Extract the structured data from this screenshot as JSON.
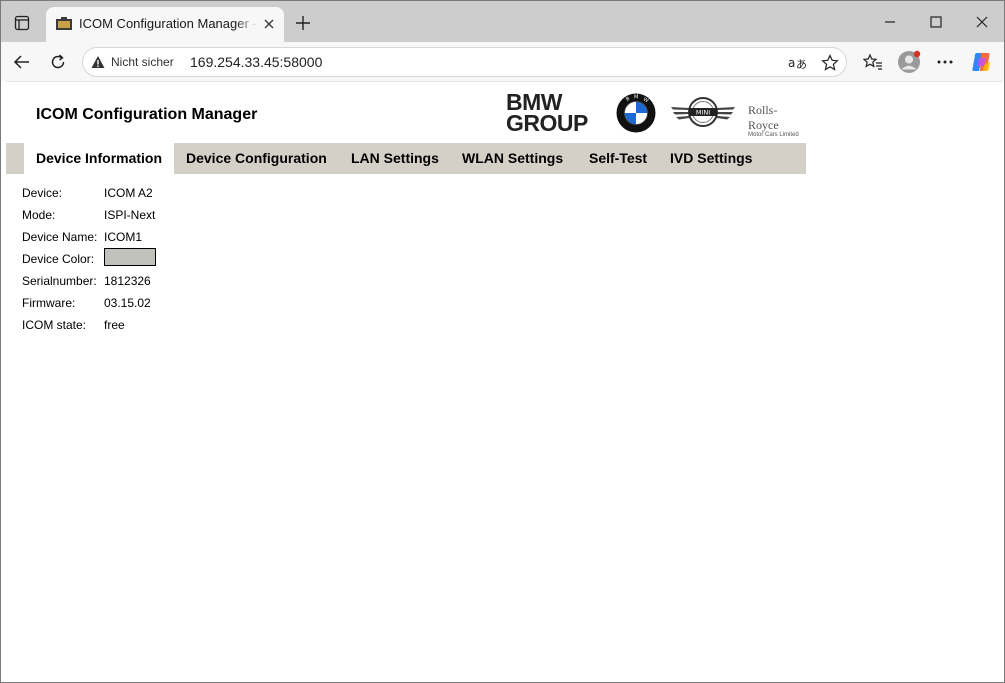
{
  "browser": {
    "tab_title": "ICOM Configuration Manager - Device Information",
    "security_label": "Nicht sicher",
    "address": "169.254.33.45:58000"
  },
  "page": {
    "app_title": "ICOM Configuration Manager",
    "brands": {
      "bmw_group_line1": "BMW",
      "bmw_group_line2": "GROUP",
      "rolls_royce": "Rolls-Royce",
      "rolls_royce_sub": "Motor Cars Limited"
    },
    "nav_tabs": [
      {
        "label": "Device Information",
        "active": true
      },
      {
        "label": "Device Configuration",
        "active": false
      },
      {
        "label": "LAN Settings",
        "active": false
      },
      {
        "label": "WLAN Settings",
        "active": false
      },
      {
        "label": "Self-Test",
        "active": false
      },
      {
        "label": "IVD Settings",
        "active": false
      }
    ],
    "device_info": {
      "device_label": "Device:",
      "device_value": "ICOM A2",
      "mode_label": "Mode:",
      "mode_value": "ISPI-Next",
      "name_label": "Device Name:",
      "name_value": "ICOM1",
      "color_label": "Device Color:",
      "color_value": "#c1c1bb",
      "serial_label": "Serialnumber:",
      "serial_value": "1812326",
      "firmware_label": "Firmware:",
      "firmware_value": "03.15.02",
      "state_label": "ICOM state:",
      "state_value": "free"
    }
  },
  "colors": {
    "tabstrip": "#cdcdcd",
    "navbar": "#d4d0c8",
    "profile_badge": "#d93025"
  }
}
